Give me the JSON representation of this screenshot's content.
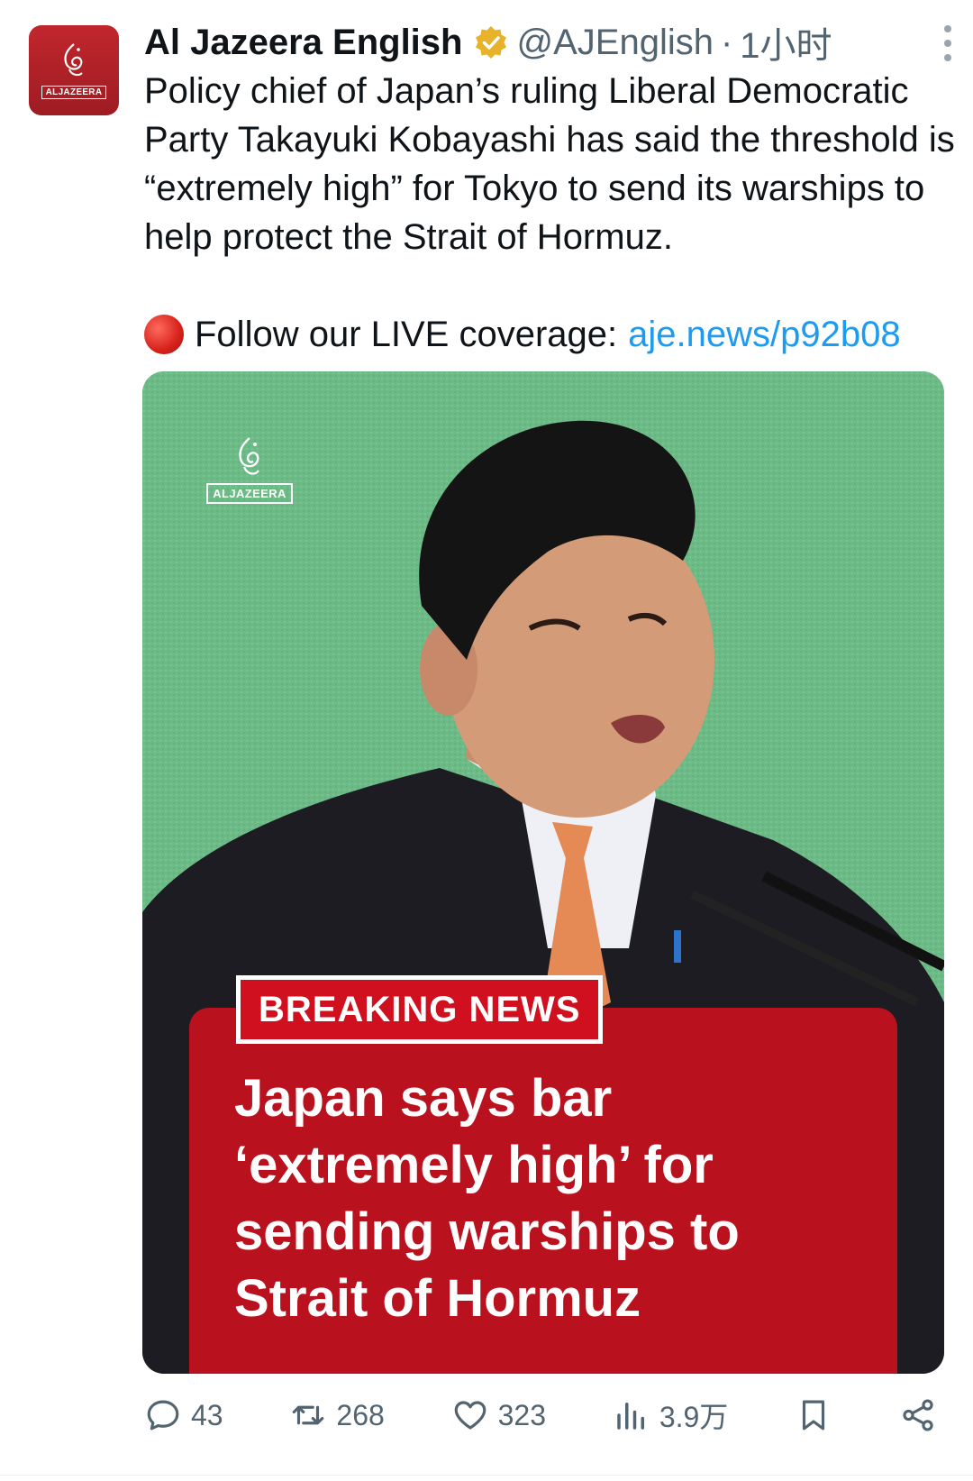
{
  "author": {
    "name": "Al Jazeera English",
    "handle": "@AJEnglish",
    "separator": "·",
    "time": "1小时",
    "avatar_wordmark": "ALJAZEERA",
    "verified_icon": "gold-checkmark-badge-icon"
  },
  "tweet": {
    "text": "Policy chief of Japan’s ruling Liberal Democratic Party Takayuki Kobayashi has said the threshold is “extremely high” for Tokyo to send its warships to help protect the Strait of Hormuz.",
    "live_prefix": "Follow our LIVE coverage:",
    "live_link": "aje.news/p92b08",
    "live_icon": "red-circle-icon"
  },
  "media": {
    "logo_wordmark": "ALJAZEERA",
    "breaking_label": "BREAKING NEWS",
    "headline": "Japan says bar\n‘extremely high’ for\nsending warships to\nStrait of Hormuz",
    "colors": {
      "background": "#6cba86",
      "panel": "#c81020"
    }
  },
  "actions": {
    "replies": "43",
    "reposts": "268",
    "likes": "323",
    "views": "3.9万"
  },
  "colors": {
    "accent": "#1d9bf0",
    "muted": "#536471",
    "text": "#0f1419"
  }
}
